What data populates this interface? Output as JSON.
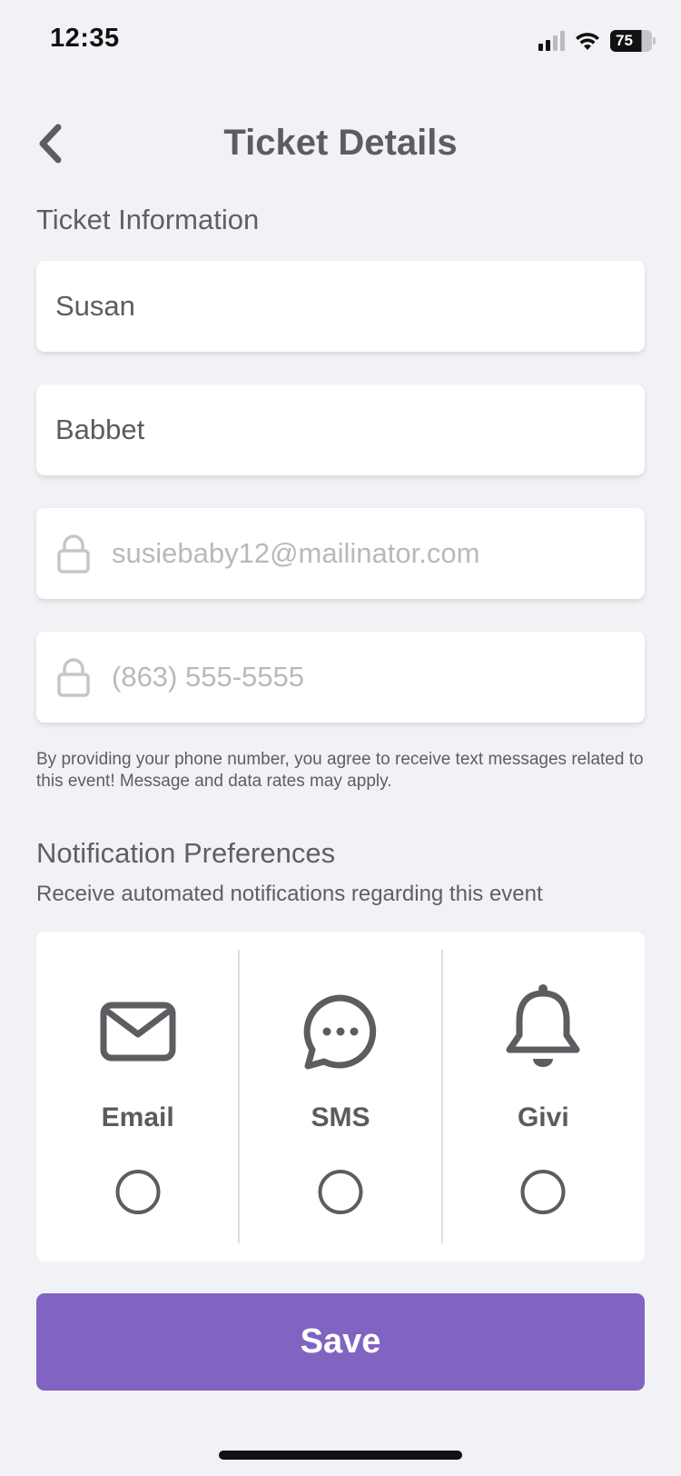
{
  "status_bar": {
    "time": "12:35",
    "battery": "75"
  },
  "header": {
    "title": "Ticket Details"
  },
  "ticket_info": {
    "title": "Ticket Information",
    "first_name": "Susan",
    "last_name": "Babbet",
    "email": "susiebaby12@mailinator.com",
    "phone": "(863) 555-5555",
    "disclaimer": "By providing your phone number, you agree to receive text messages related to this event! Message and data rates may apply."
  },
  "notifications": {
    "title": "Notification Preferences",
    "subtitle": "Receive automated notifications regarding this event",
    "options": [
      {
        "label": "Email",
        "icon": "envelope-icon",
        "selected": false
      },
      {
        "label": "SMS",
        "icon": "chat-bubble-icon",
        "selected": false
      },
      {
        "label": "Givi",
        "icon": "bell-icon",
        "selected": false
      }
    ]
  },
  "actions": {
    "save_label": "Save"
  },
  "colors": {
    "accent": "#8163c1",
    "background": "#f1f2f5",
    "text": "#5f6064"
  }
}
